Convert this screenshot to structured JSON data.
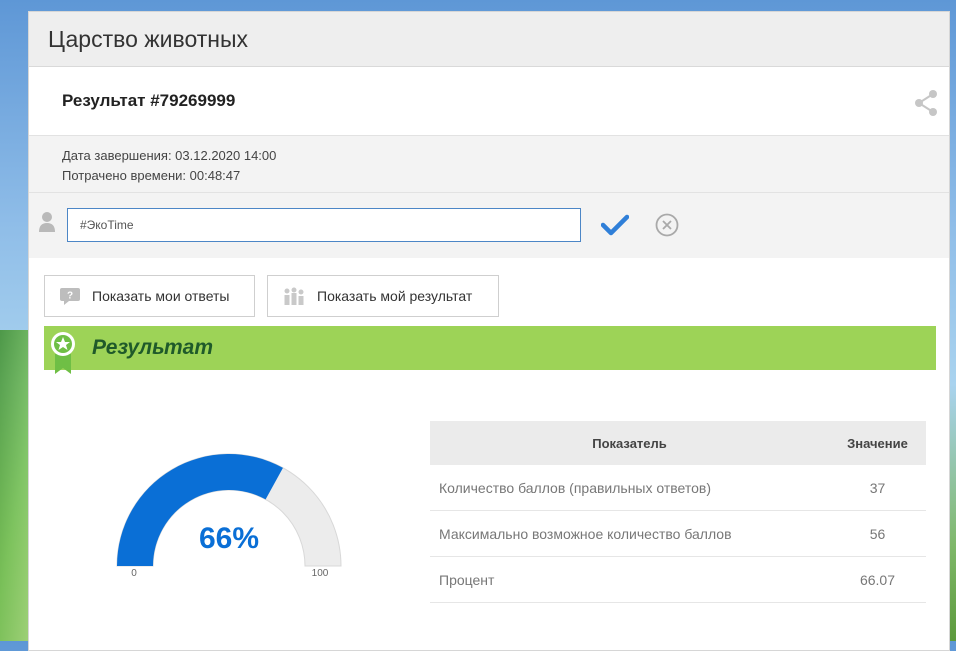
{
  "page": {
    "title": "Царство животных"
  },
  "result": {
    "heading": "Результат #79269999"
  },
  "meta": {
    "completion": "Дата завершения: 03.12.2020 14:00",
    "time_spent": "Потрачено времени: 00:48:47"
  },
  "tag": {
    "value": "#ЭкоTime"
  },
  "buttons": {
    "show_answers": "Показать мои ответы",
    "show_result": "Показать мой результат"
  },
  "banner": {
    "title": "Результат"
  },
  "gauge": {
    "label": "66%",
    "min_label": "0",
    "max_label": "100",
    "value_percent": 66,
    "fill_color": "#0a6fd6",
    "track_color": "#ececec"
  },
  "table": {
    "headers": [
      "Показатель",
      "Значение"
    ],
    "rows": [
      {
        "name": "Количество баллов (правильных ответов)",
        "value": "37"
      },
      {
        "name": "Максимально возможное количество баллов",
        "value": "56"
      },
      {
        "name": "Процент",
        "value": "66.07"
      }
    ]
  },
  "colors": {
    "accent": "#0a6fd6",
    "banner": "#9dd357",
    "check": "#2f7fd8"
  },
  "icons": [
    "share-icon",
    "user-icon",
    "checkmark-icon",
    "close-circle-icon",
    "question-icon",
    "chart-icon",
    "award-badge-icon"
  ]
}
